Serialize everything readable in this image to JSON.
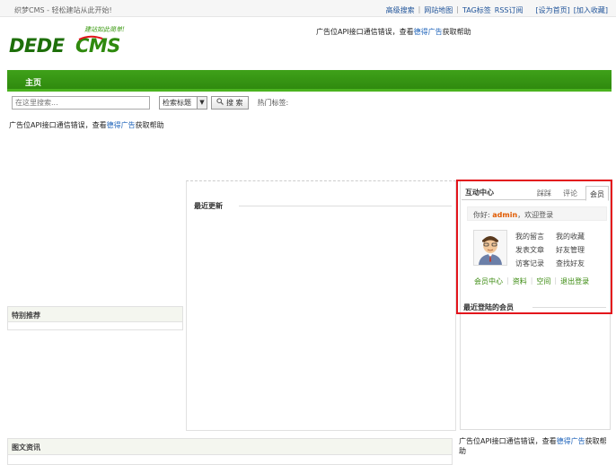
{
  "topbar": {
    "welcome": "织梦CMS - 轻松建站从此开始!",
    "links": [
      "高级搜索",
      "网站地图",
      "TAG标签",
      "RSS订阅",
      "[设为首页]",
      "[加入收藏]"
    ]
  },
  "logo": {
    "text": "DEDECMS",
    "slogan": "建站如此简单!"
  },
  "ad_header": {
    "prefix": "广告位API接口通信错误，查看",
    "link": "德得广告",
    "suffix": "获取帮助"
  },
  "nav": {
    "home": "主页"
  },
  "search": {
    "placeholder": "在这里搜索...",
    "type_selected": "检索标题",
    "button": "搜 索",
    "hot_tags_label": "热门标签:"
  },
  "ad_main": {
    "prefix": "广告位API接口通信错误，查看",
    "link": "德得广告",
    "suffix": "获取帮助"
  },
  "latest": {
    "title": "最近更新"
  },
  "recommend": {
    "title": "特别推荐"
  },
  "pictures": {
    "title": "图文资讯"
  },
  "member": {
    "title": "互动中心",
    "tabs": [
      "踩踩",
      "评论",
      "会员"
    ],
    "hello_prefix": "你好:",
    "username": "admin",
    "hello_suffix": "，欢迎登录",
    "links": [
      "我的留言",
      "我的收藏",
      "发表文章",
      "好友管理",
      "访客记录",
      "查找好友"
    ],
    "member_links": [
      "会员中心",
      "资料",
      "空间",
      "退出登录"
    ],
    "recent_title": "最近登陆的会员"
  },
  "ad_right": {
    "prefix": "广告位API接口通信错误，查看",
    "link": "德得广告",
    "suffix": "获取帮助"
  },
  "colors": {
    "nav_green": "#2f8a0e",
    "highlight_red": "#e3141c",
    "link_blue": "#2266bb"
  }
}
